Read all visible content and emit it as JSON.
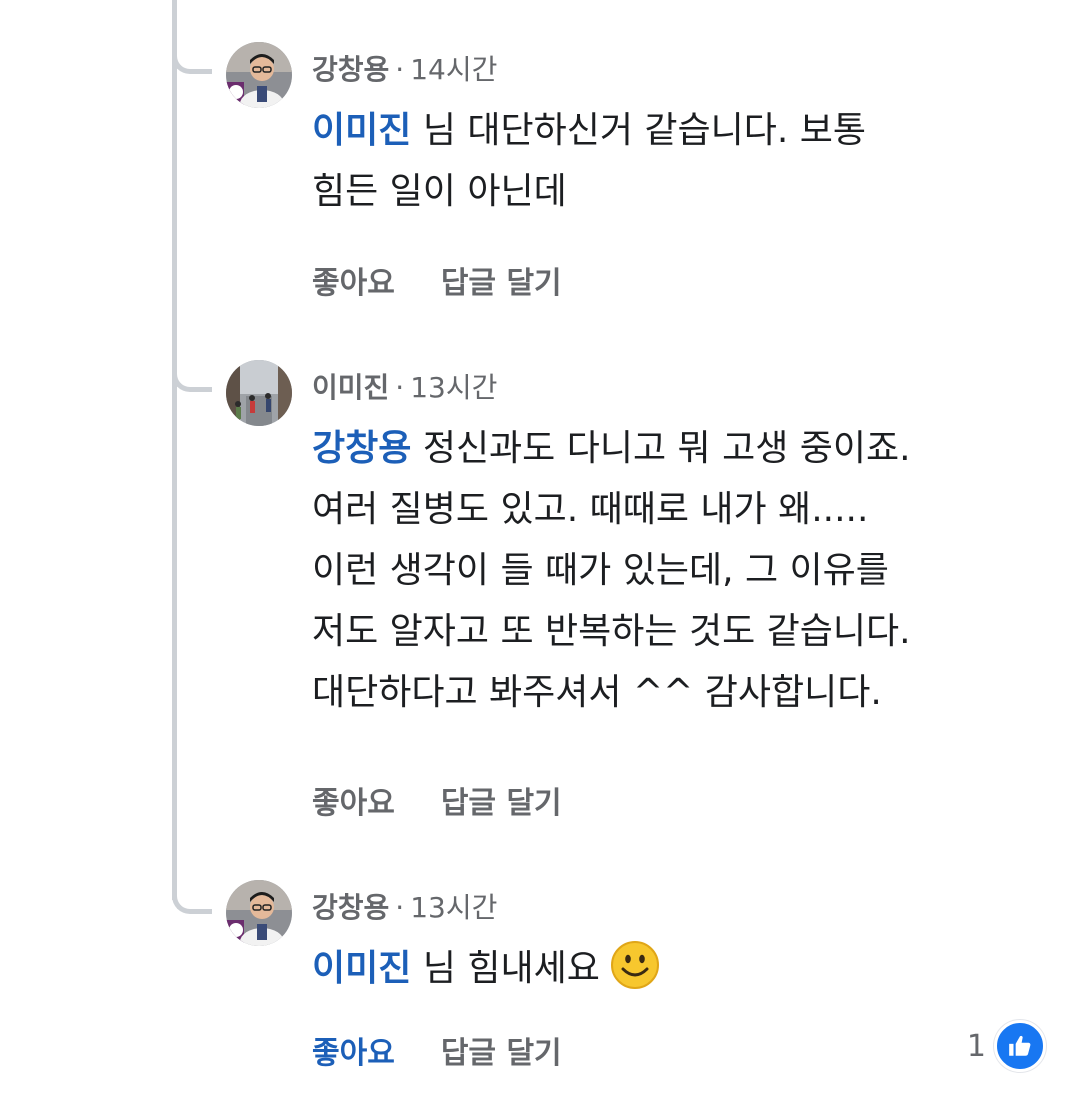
{
  "comments": [
    {
      "author": "강창용",
      "time": "14시간",
      "mention": "이미진",
      "lines": [
        " 님 대단하신거 같습니다. 보통",
        "힘든 일이 아닌데"
      ],
      "like_label": "좋아요",
      "reply_label": "답글 달기",
      "avatar": "profile-photo-man-glasses"
    },
    {
      "author": "이미진",
      "time": "13시간",
      "mention": "강창용",
      "lines": [
        " 정신과도 다니고 뭐 고생 중이죠.",
        "여러 질병도 있고. 때때로 내가 왜.....",
        "이런 생각이 들 때가 있는데, 그 이유를",
        "저도 알자고 또 반복하는 것도 같습니다.",
        "대단하다고 봐주셔서 ^^ 감사합니다."
      ],
      "like_label": "좋아요",
      "reply_label": "답글 달기",
      "avatar": "profile-photo-street"
    },
    {
      "author": "강창용",
      "time": "13시간",
      "mention": "이미진",
      "lines": [
        " 님 힘내세요"
      ],
      "emoji": "smiling-face-icon",
      "like_label": "좋아요",
      "reply_label": "답글 달기",
      "avatar": "profile-photo-man-glasses",
      "liked": true,
      "reaction_count": "1",
      "reaction_icon": "thumbs-up-icon"
    }
  ],
  "colors": {
    "mention": "#1c5fb8",
    "meta": "#65676b",
    "text": "#1c1e21",
    "like_badge": "#1877f2",
    "thread_line": "#ccd0d5"
  }
}
